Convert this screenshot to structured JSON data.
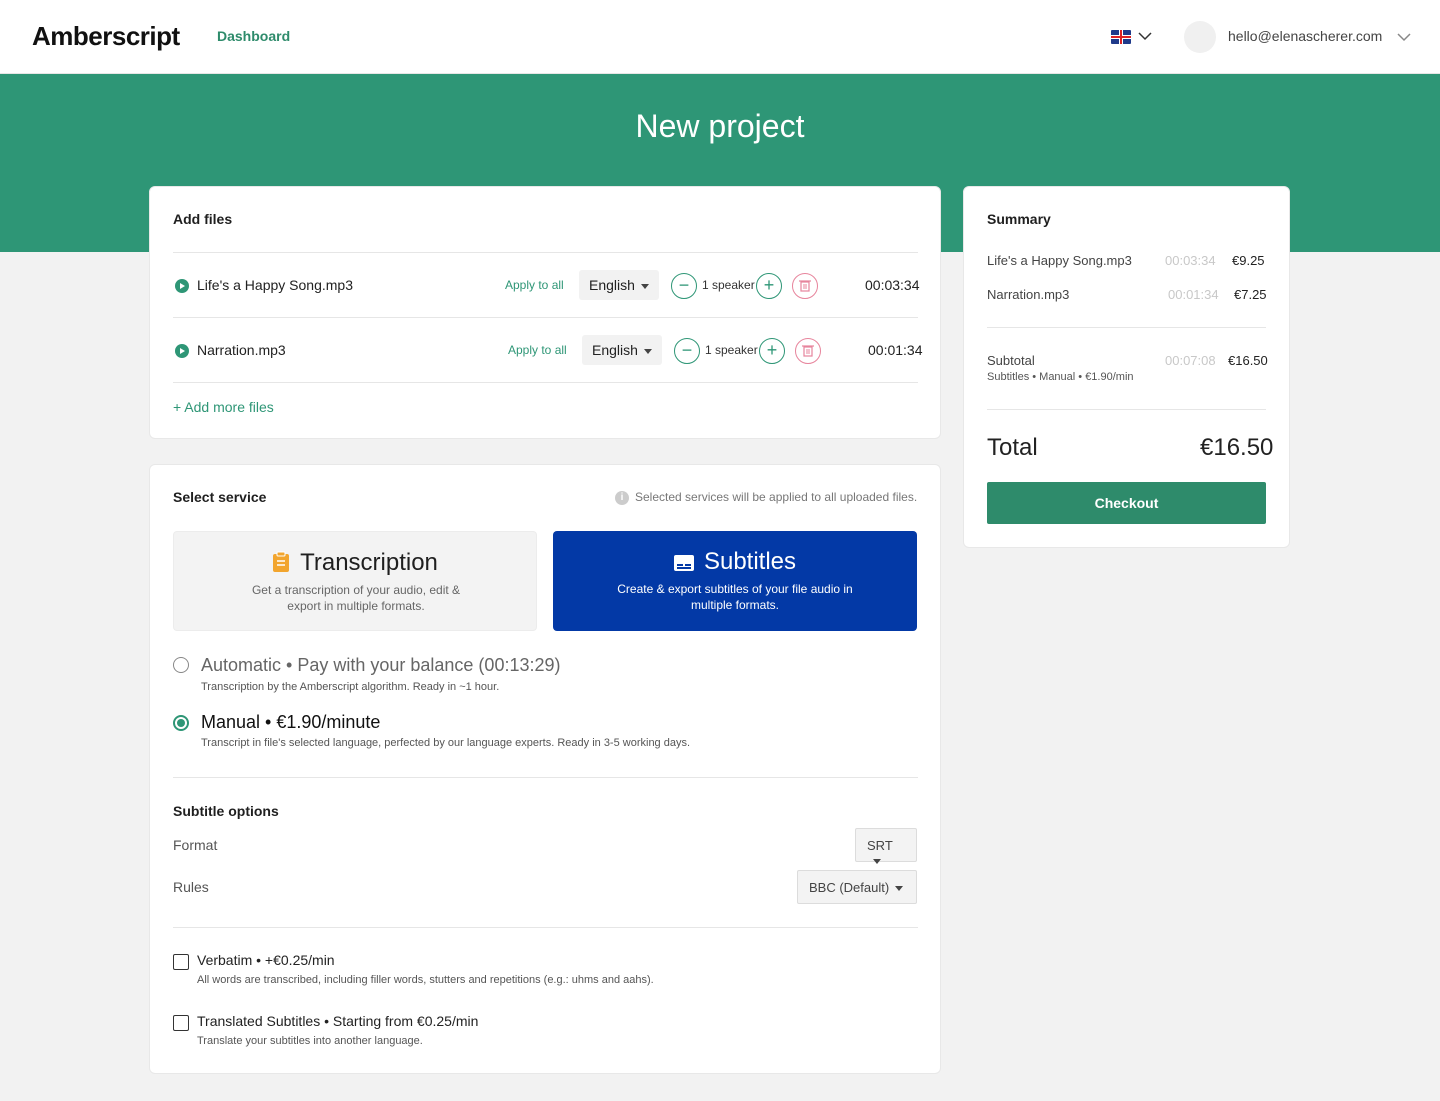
{
  "header": {
    "logo": "Amberscript",
    "nav_dashboard": "Dashboard",
    "user_email": "hello@elenascherer.com"
  },
  "hero": {
    "title": "New project"
  },
  "add_files": {
    "title": "Add files",
    "files": [
      {
        "name": "Life's a Happy Song.mp3",
        "apply_label": "Apply to all",
        "language": "English",
        "speakers": "1 speaker",
        "duration": "00:03:34"
      },
      {
        "name": "Narration.mp3",
        "apply_label": "Apply to all",
        "language": "English",
        "speakers": "1 speaker",
        "duration": "00:01:34"
      }
    ],
    "add_more_label": "+ Add more files"
  },
  "select_service": {
    "title": "Select service",
    "note": "Selected services will be applied to all uploaded files.",
    "services": [
      {
        "name": "Transcription",
        "desc": "Get a transcription of your audio, edit & export in multiple formats.",
        "selected": false
      },
      {
        "name": "Subtitles",
        "desc": "Create & export subtitles of your file audio in multiple formats.",
        "selected": true
      }
    ],
    "options": [
      {
        "main": "Automatic • Pay with your balance (00:13:29)",
        "sub": "Transcription by the Amberscript algorithm. Ready in ~1 hour.",
        "selected": false
      },
      {
        "main": "Manual • €1.90/minute",
        "sub": "Transcript in file's selected language, perfected by our language experts. Ready in 3-5 working days.",
        "selected": true
      }
    ],
    "subtitle_options": {
      "title": "Subtitle options",
      "format_label": "Format",
      "format_value": "SRT",
      "rules_label": "Rules",
      "rules_value": "BBC (Default)"
    },
    "addons": [
      {
        "main": "Verbatim • +€0.25/min",
        "sub": "All words are transcribed, including filler words, stutters and repetitions (e.g.: uhms and aahs).",
        "checked": false
      },
      {
        "main": "Translated Subtitles • Starting from €0.25/min",
        "sub": "Translate your subtitles into another language.",
        "checked": false
      }
    ]
  },
  "summary": {
    "title": "Summary",
    "items": [
      {
        "name": "Life's a Happy Song.mp3",
        "duration": "00:03:34",
        "price": "€9.25"
      },
      {
        "name": "Narration.mp3",
        "duration": "00:01:34",
        "price": "€7.25"
      }
    ],
    "subtotal_label": "Subtotal",
    "subtotal_detail": "Subtitles • Manual • €1.90/min",
    "subtotal_duration": "00:07:08",
    "subtotal_price": "€16.50",
    "total_label": "Total",
    "total_price": "€16.50",
    "checkout_label": "Checkout"
  },
  "colors": {
    "brand_green": "#2e9676",
    "subtitles_blue": "#0339a6",
    "delete_pink": "#e7849c"
  }
}
